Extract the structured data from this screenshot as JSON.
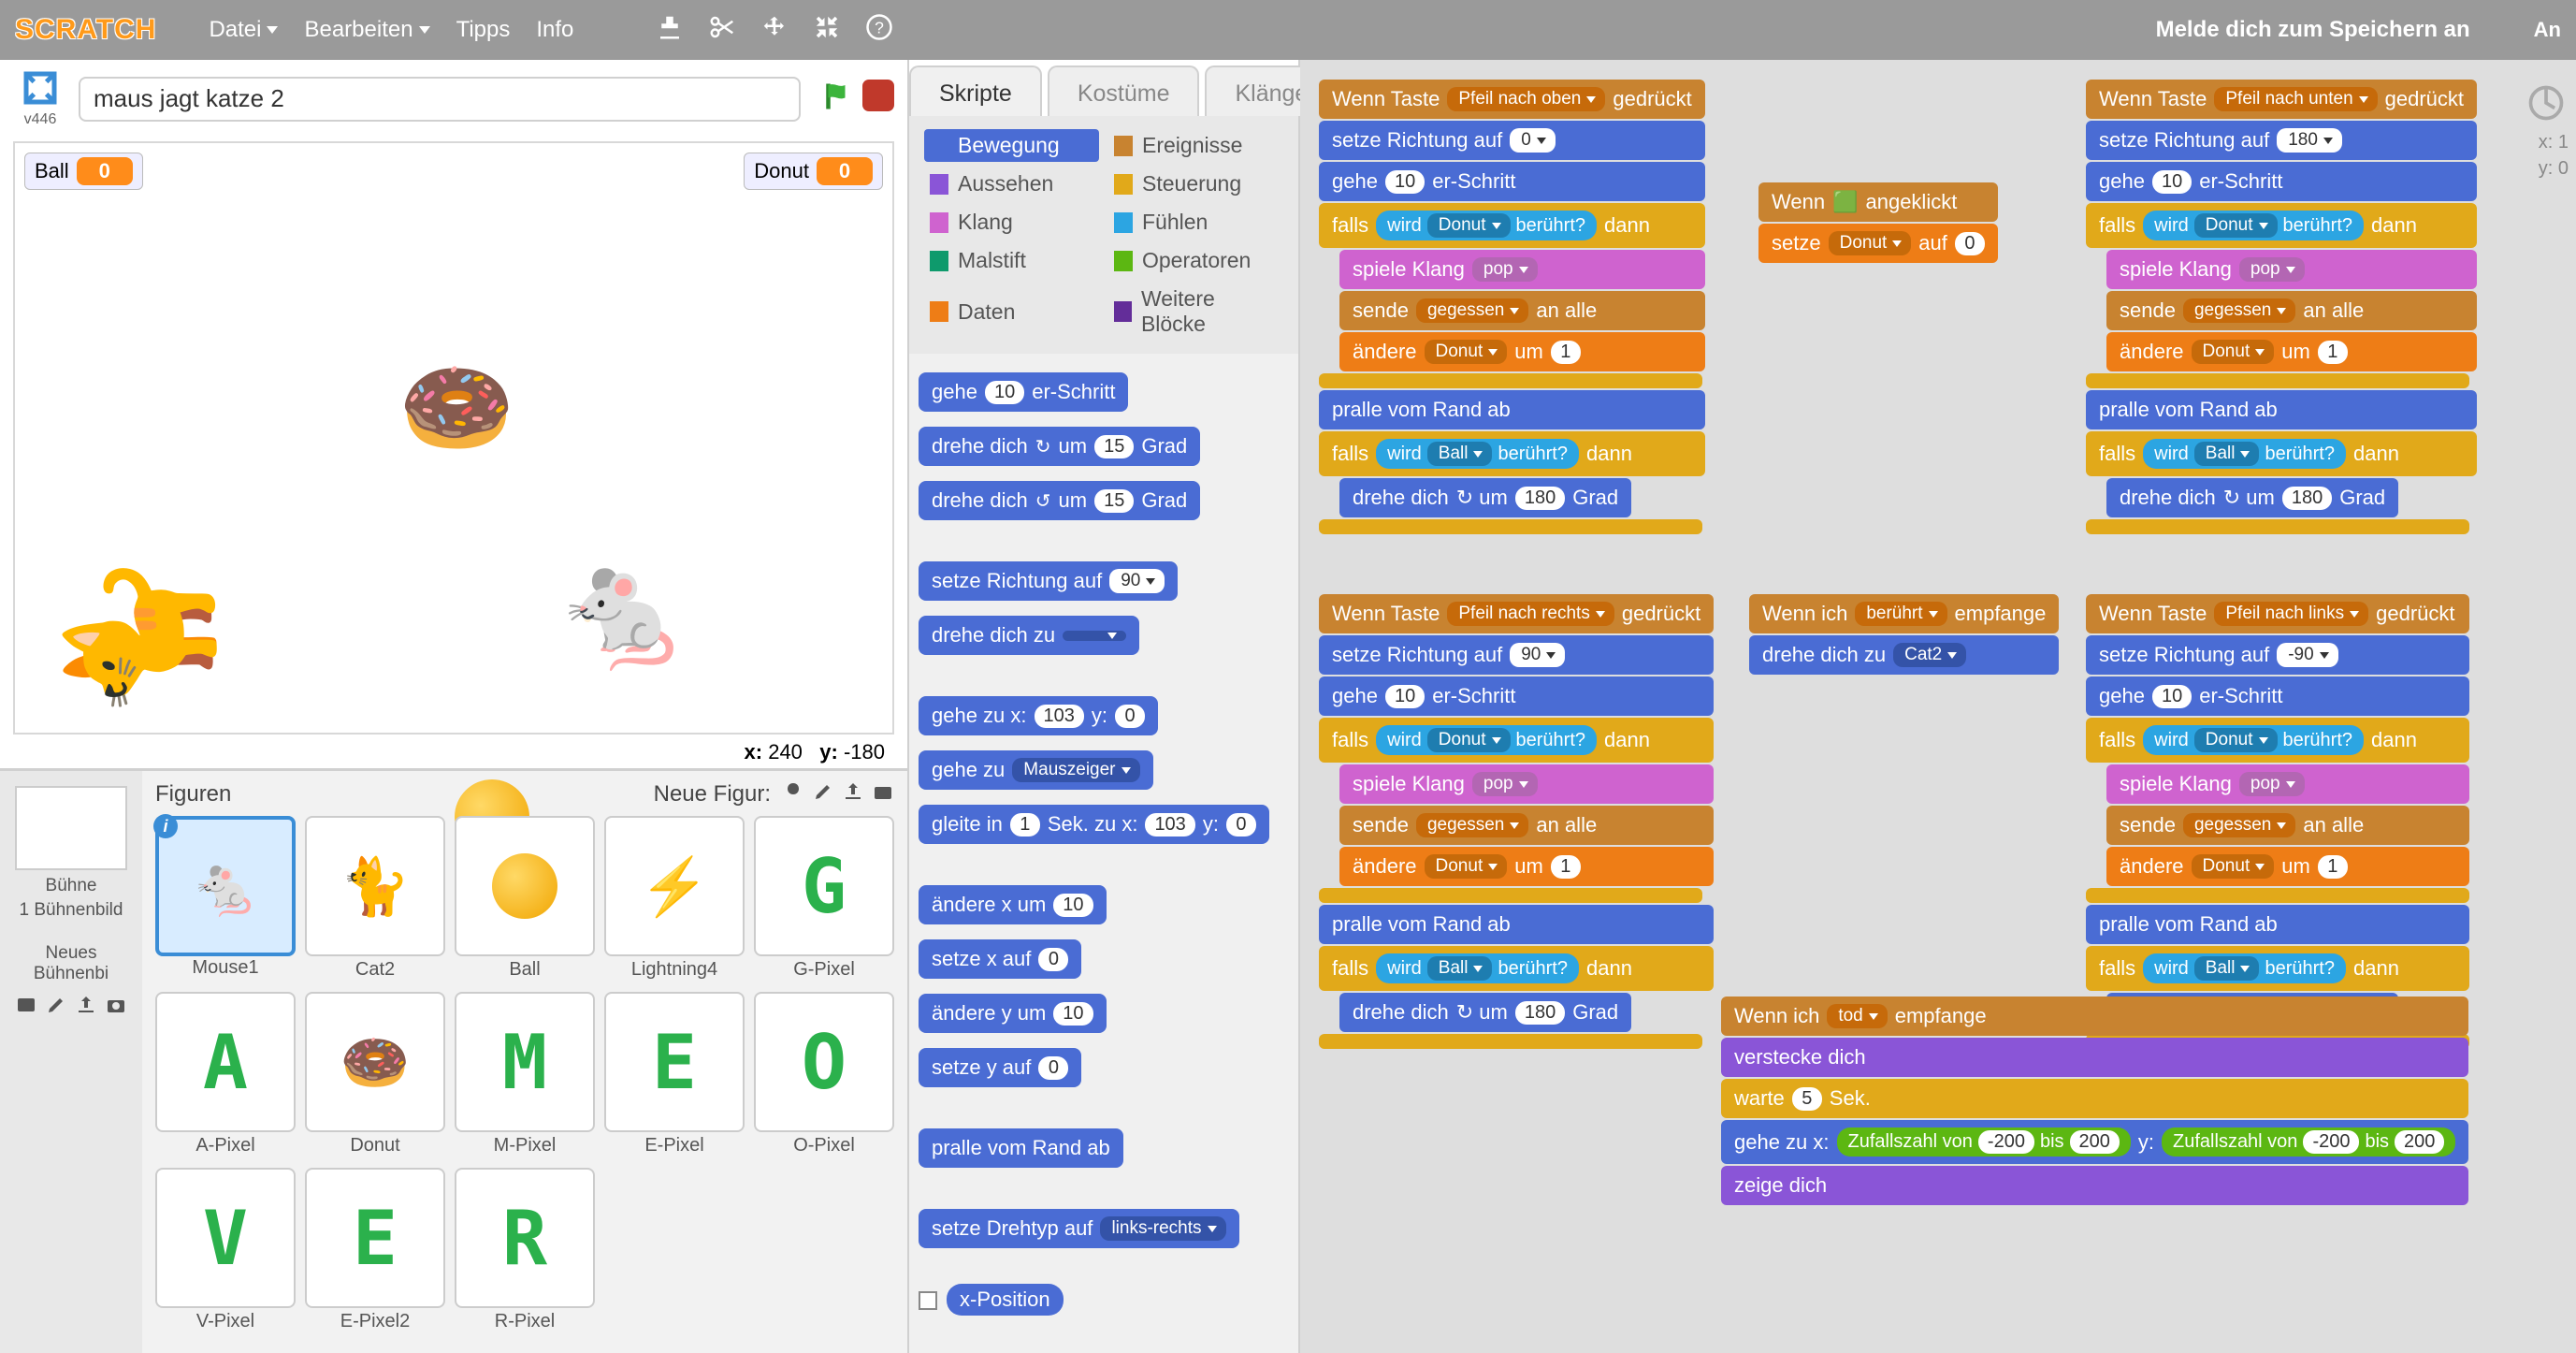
{
  "topbar": {
    "logo": "SCRATCH",
    "menu": {
      "file": "Datei",
      "edit": "Bearbeiten",
      "tips": "Tipps",
      "info": "Info"
    },
    "sign_in": "Melde dich zum Speichern an",
    "an": "An"
  },
  "project": {
    "title": "maus jagt katze 2",
    "version": "v446"
  },
  "stage_vars": {
    "ball_label": "Ball",
    "ball_value": "0",
    "donut_label": "Donut",
    "donut_value": "0"
  },
  "coords": {
    "x_label": "x:",
    "x": "240",
    "y_label": "y:",
    "y": "-180"
  },
  "sprite_panel": {
    "figures_label": "Figuren",
    "new_figure_label": "Neue Figur:",
    "stage_label": "Bühne",
    "backdrop_count": "1 Bühnenbild",
    "new_backdrop": "Neues Bühnenbi",
    "sprites": [
      {
        "name": "Mouse1"
      },
      {
        "name": "Cat2"
      },
      {
        "name": "Ball"
      },
      {
        "name": "Lightning4"
      },
      {
        "name": "G-Pixel"
      },
      {
        "name": "A-Pixel"
      },
      {
        "name": "Donut"
      },
      {
        "name": "M-Pixel"
      },
      {
        "name": "E-Pixel"
      },
      {
        "name": "O-Pixel"
      },
      {
        "name": "V-Pixel"
      },
      {
        "name": "E-Pixel2"
      },
      {
        "name": "R-Pixel"
      }
    ]
  },
  "tabs": {
    "scripts": "Skripte",
    "costumes": "Kostüme",
    "sounds": "Klänge"
  },
  "categories": {
    "motion": "Bewegung",
    "looks": "Aussehen",
    "sound": "Klang",
    "pen": "Malstift",
    "data": "Daten",
    "events": "Ereignisse",
    "control": "Steuerung",
    "sensing": "Fühlen",
    "operators": "Operatoren",
    "more": "Weitere Blöcke"
  },
  "palette": {
    "move": "gehe",
    "steps": "er-Schritt",
    "steps_n": "10",
    "turn_cw": "drehe dich",
    "deg": "Grad",
    "deg_n": "15",
    "point_dir": "setze Richtung auf",
    "dir90": "90",
    "point_towards": "drehe dich zu",
    "goto_xy": "gehe zu x:",
    "y": "y:",
    "gx": "103",
    "gy": "0",
    "goto": "gehe zu",
    "mouseptr": "Mauszeiger",
    "glide": "gleite in",
    "sec": "Sek. zu x:",
    "glide_s": "1",
    "glide_x": "103",
    "glide_y": "0",
    "change_x": "ändere x um",
    "set_x": "setze x auf",
    "change_y": "ändere y um",
    "set_y": "setze y auf",
    "n10": "10",
    "n0": "0",
    "bounce": "pralle vom Rand ab",
    "rot_style": "setze Drehtyp auf",
    "lr": "links-rechts",
    "xpos": "x-Position"
  },
  "scripts": {
    "when_key": "Wenn Taste",
    "pressed": "gedrückt",
    "up": "Pfeil nach oben",
    "down": "Pfeil nach unten",
    "right": "Pfeil nach rechts",
    "left": "Pfeil nach links",
    "set_dir": "setze Richtung auf",
    "d0": "0",
    "d180": "180",
    "d90": "90",
    "d_90": "-90",
    "move": "gehe",
    "steps": "er-Schritt",
    "n10": "10",
    "if": "falls",
    "then": "dann",
    "touching": "wird",
    "touching2": "berührt?",
    "donut": "Donut",
    "ball": "Ball",
    "play_sound": "spiele Klang",
    "pop": "pop",
    "broadcast": "sende",
    "to_all": "an alle",
    "gegessen": "gegessen",
    "change_var": "ändere",
    "by": "um",
    "n1": "1",
    "bounce": "pralle vom Rand ab",
    "turn": "drehe dich",
    "deg180": "180",
    "deg": "Grad",
    "when_flag": "Wenn",
    "clicked": "angeklickt",
    "set_var": "setze",
    "to": "auf",
    "n0": "0",
    "when_rcv": "Wenn ich",
    "receive": "empfange",
    "beruhrt": "berührt",
    "tod": "tod",
    "point_to": "drehe dich zu",
    "cat2": "Cat2",
    "hide": "verstecke dich",
    "wait": "warte",
    "n5": "5",
    "sek": "Sek.",
    "goto_xy": "gehe zu x:",
    "y": "y:",
    "rand": "Zufallszahl von",
    "to2": "bis",
    "r1": "-200",
    "r2": "200",
    "show": "zeige dich"
  },
  "mini": {
    "x_lbl": "x:",
    "x": "1",
    "y_lbl": "y:",
    "y": "0"
  }
}
